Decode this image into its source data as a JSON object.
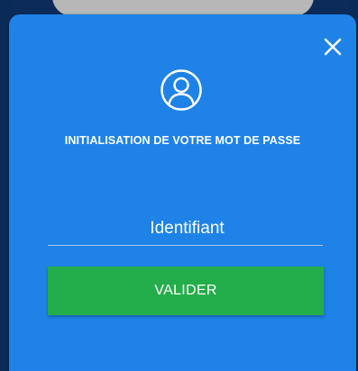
{
  "dialog": {
    "title": "INITIALISATION DE VOTRE MOT DE PASSE",
    "close_icon": "close-icon",
    "avatar_icon": "user-circle-icon"
  },
  "form": {
    "identifier_placeholder": "Identifiant",
    "identifier_value": "",
    "submit_label": "VALIDER"
  },
  "colors": {
    "card_background": "#1e82e6",
    "submit_background": "#24ad4b",
    "text": "#ffffff"
  }
}
